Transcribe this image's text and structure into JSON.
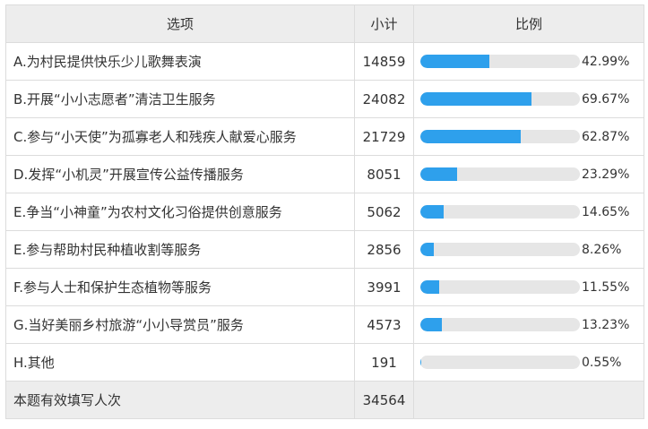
{
  "header": {
    "option": "选项",
    "count": "小计",
    "ratio": "比例"
  },
  "rows": [
    {
      "label": "A.为村民提供快乐少儿歌舞表演",
      "count": "14859",
      "percent_text": "42.99%",
      "percent": 42.99
    },
    {
      "label": "B.开展“小小志愿者”清洁卫生服务",
      "count": "24082",
      "percent_text": "69.67%",
      "percent": 69.67
    },
    {
      "label": "C.参与“小天使”为孤寡老人和残疾人献爱心服务",
      "count": "21729",
      "percent_text": "62.87%",
      "percent": 62.87
    },
    {
      "label": "D.发挥“小机灵”开展宣传公益传播服务",
      "count": "8051",
      "percent_text": "23.29%",
      "percent": 23.29
    },
    {
      "label": "E.争当“小神童”为农村文化习俗提供创意服务",
      "count": "5062",
      "percent_text": "14.65%",
      "percent": 14.65
    },
    {
      "label": "E.参与帮助村民种植收割等服务",
      "count": "2856",
      "percent_text": "8.26%",
      "percent": 8.26
    },
    {
      "label": "F.参与人士和保护生态植物等服务",
      "count": "3991",
      "percent_text": "11.55%",
      "percent": 11.55
    },
    {
      "label": "G.当好美丽乡村旅游“小小导赏员”服务",
      "count": "4573",
      "percent_text": "13.23%",
      "percent": 13.23
    },
    {
      "label": "H.其他",
      "count": "191",
      "percent_text": "0.55%",
      "percent": 0.55
    }
  ],
  "footer": {
    "label": "本题有效填写人次",
    "count": "34564"
  },
  "colors": {
    "bar_fill": "#2ea0ec",
    "bar_track": "#e6e6e6",
    "header_bg": "#ededed"
  }
}
